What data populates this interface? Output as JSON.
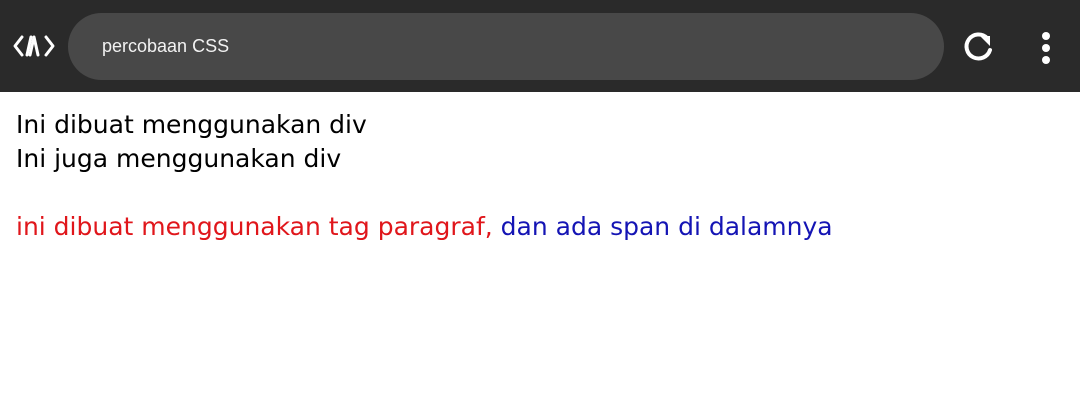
{
  "browser": {
    "url_text": "percobaan CSS",
    "icons": {
      "app": "code-brackets-icon",
      "reload": "reload-icon",
      "menu": "kebab-menu-icon"
    },
    "colors": {
      "toolbar": "#2a2a2a",
      "url_bar": "#484848",
      "icon": "#ffffff"
    }
  },
  "page": {
    "div1": "Ini dibuat menggunakan div",
    "div2": "Ini juga menggunakan div",
    "paragraph_text": "ini dibuat menggunakan tag paragraf,",
    "span_text": " dan ada span di dalamnya",
    "colors": {
      "paragraph": "#e0161b",
      "span": "#1414b4"
    }
  }
}
